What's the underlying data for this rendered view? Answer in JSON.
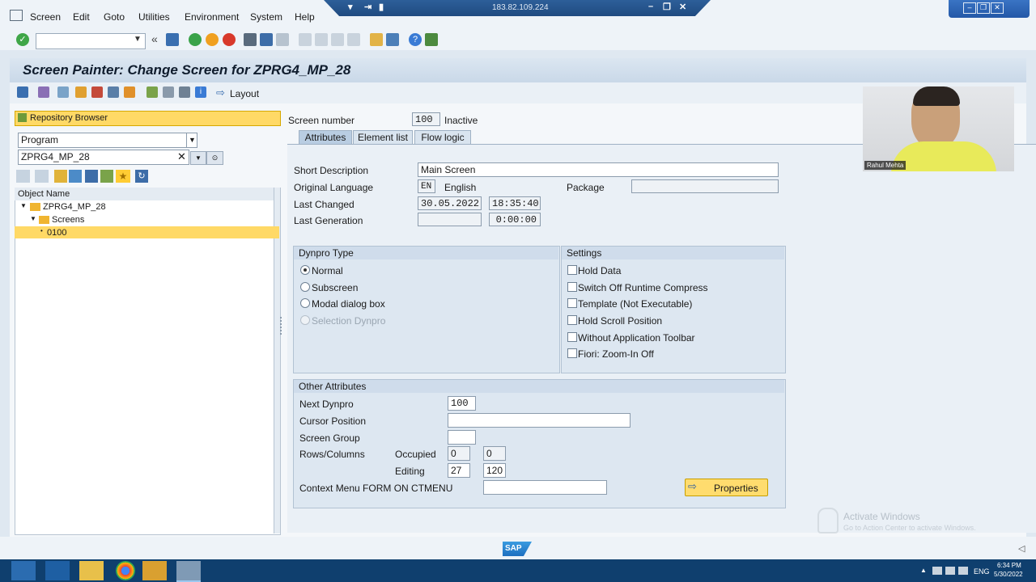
{
  "menu": [
    "Screen",
    "Edit",
    "Goto",
    "Utilities",
    "Environment",
    "System",
    "Help"
  ],
  "connection": {
    "ip": "183.82.109.224"
  },
  "title": "Screen Painter: Change Screen for ZPRG4_MP_28",
  "app_toolbar": {
    "layout_label": "Layout"
  },
  "repository": {
    "title": "Repository Browser",
    "object_type": "Program",
    "object_name": "ZPRG4_MP_28",
    "column_header": "Object Name",
    "tree": {
      "root": "ZPRG4_MP_28",
      "folder": "Screens",
      "item": "0100"
    }
  },
  "screen": {
    "number_label": "Screen number",
    "number": "100",
    "status": "Inactive",
    "tabs": [
      "Attributes",
      "Element list",
      "Flow logic"
    ]
  },
  "attributes": {
    "short_desc_label": "Short Description",
    "short_desc": "Main Screen",
    "orig_lang_label": "Original Language",
    "orig_lang_code": "EN",
    "orig_lang_name": "English",
    "package_label": "Package",
    "package": "",
    "last_changed_label": "Last Changed",
    "last_changed_date": "30.05.2022",
    "last_changed_time": "18:35:40",
    "last_gen_label": "Last Generation",
    "last_gen_date": "",
    "last_gen_time": "0:00:00"
  },
  "dynpro_type": {
    "title": "Dynpro Type",
    "options": [
      "Normal",
      "Subscreen",
      "Modal dialog box",
      "Selection Dynpro"
    ],
    "selected": "Normal"
  },
  "settings": {
    "title": "Settings",
    "options": [
      "Hold Data",
      "Switch Off Runtime Compress",
      "Template (Not Executable)",
      "Hold Scroll Position",
      "Without Application Toolbar",
      "Fiori: Zoom-In Off"
    ]
  },
  "other": {
    "title": "Other Attributes",
    "next_dynpro_label": "Next Dynpro",
    "next_dynpro": "100",
    "cursor_label": "Cursor Position",
    "screen_group_label": "Screen Group",
    "rows_cols_label": "Rows/Columns",
    "occupied_label": "Occupied",
    "occupied_rows": "0",
    "occupied_cols": "0",
    "editing_label": "Editing",
    "editing_rows": "27",
    "editing_cols": "120",
    "context_menu_label": "Context Menu FORM ON CTMENU",
    "properties_button": "Properties"
  },
  "webcam": {
    "name": "Rahul Mehta"
  },
  "watermark": {
    "title": "Activate Windows",
    "subtitle": "Go to Action Center to activate Windows."
  },
  "taskbar": {
    "lang": "ENG",
    "time": "6:34 PM",
    "date": "5/30/2022"
  },
  "colors": {
    "accent": "#ffd966",
    "title_bar": "#c9d8e8",
    "taskbar": "#0f3f6e"
  }
}
